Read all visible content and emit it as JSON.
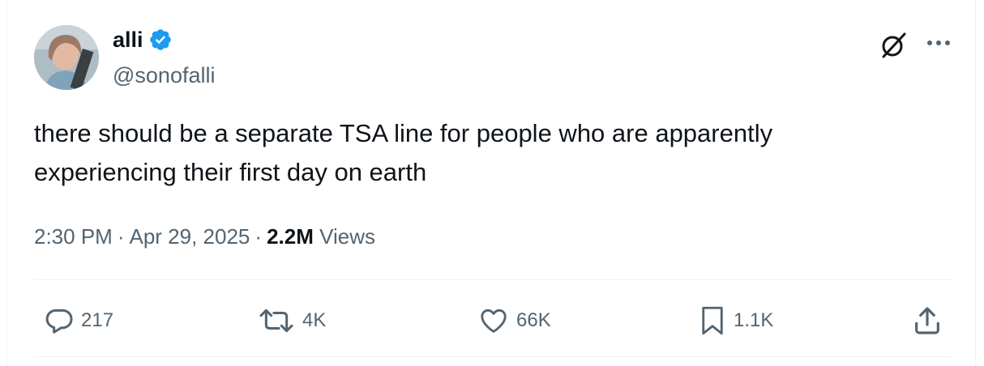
{
  "author": {
    "display_name": "alli",
    "handle": "@sonofalli",
    "verified_icon": "verified-badge-icon",
    "verified_color": "#1d9bf0"
  },
  "tweet": {
    "text": "there should be a separate TSA line for people who are apparently\nexperiencing their first day on earth",
    "time": "2:30 PM",
    "date": "Apr 29, 2025",
    "separator": "·",
    "views_count": "2.2M",
    "views_label": "Views"
  },
  "actions": {
    "replies": "217",
    "reposts": "4K",
    "likes": "66K",
    "bookmarks": "1.1K"
  },
  "icons": {
    "grok": "grok-icon",
    "more": "more-options-icon",
    "reply": "reply-icon",
    "repost": "repost-icon",
    "like": "like-icon",
    "bookmark": "bookmark-icon",
    "share": "share-icon"
  },
  "colors": {
    "text_primary": "#0f1419",
    "text_secondary": "#536471",
    "divider": "#eff3f4",
    "accent": "#1d9bf0"
  }
}
